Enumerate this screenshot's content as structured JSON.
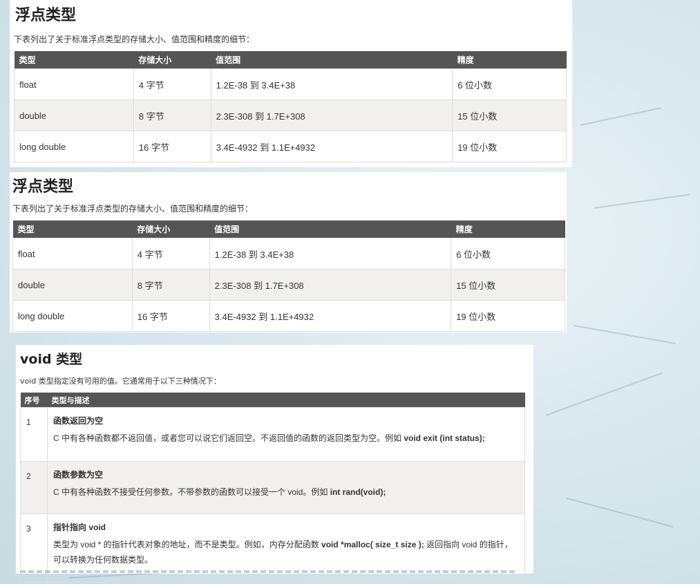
{
  "float_section_1": {
    "title": "浮点类型",
    "description": "下表列出了关于标准浮点类型的存储大小、值范围和精度的细节：",
    "headers": [
      "类型",
      "存储大小",
      "值范围",
      "精度"
    ],
    "rows": [
      [
        "float",
        "4 字节",
        "1.2E-38 到 3.4E+38",
        "6 位小数"
      ],
      [
        "double",
        "8 字节",
        "2.3E-308 到 1.7E+308",
        "15 位小数"
      ],
      [
        "long double",
        "16 字节",
        "3.4E-4932 到 1.1E+4932",
        "19 位小数"
      ]
    ]
  },
  "float_section_2": {
    "title": "浮点类型",
    "description": "下表列出了关于标准浮点类型的存储大小、值范围和精度的细节：",
    "headers": [
      "类型",
      "存储大小",
      "值范围",
      "精度"
    ],
    "rows": [
      [
        "float",
        "4 字节",
        "1.2E-38 到 3.4E+38",
        "6 位小数"
      ],
      [
        "double",
        "8 字节",
        "2.3E-308 到 1.7E+308",
        "15 位小数"
      ],
      [
        "long double",
        "16 字节",
        "3.4E-4932 到 1.1E+4932",
        "19 位小数"
      ]
    ]
  },
  "void_section": {
    "title": "void 类型",
    "description": "void 类型指定没有可用的值。它通常用于以下三种情况下：",
    "headers": [
      "序号",
      "类型与描述"
    ],
    "rows": [
      {
        "num": "1",
        "title": "函数返回为空",
        "text": "C 中有各种函数都不返回值，或者您可以说它们返回空。不返回值的函数的返回类型为空。例如 ",
        "code": "void exit (int status);",
        "after": ""
      },
      {
        "num": "2",
        "title": "函数参数为空",
        "text": "C 中有各种函数不接受任何参数。不带参数的函数可以接受一个 void。例如 ",
        "code": "int rand(void);",
        "after": ""
      },
      {
        "num": "3",
        "title": "指针指向 void",
        "text": "类型为 void * 的指针代表对象的地址，而不是类型。例如，内存分配函数 ",
        "code": "void *malloc( size_t size );",
        "after": " 返回指向 void 的指针，可以转换为任何数据类型。"
      }
    ]
  }
}
